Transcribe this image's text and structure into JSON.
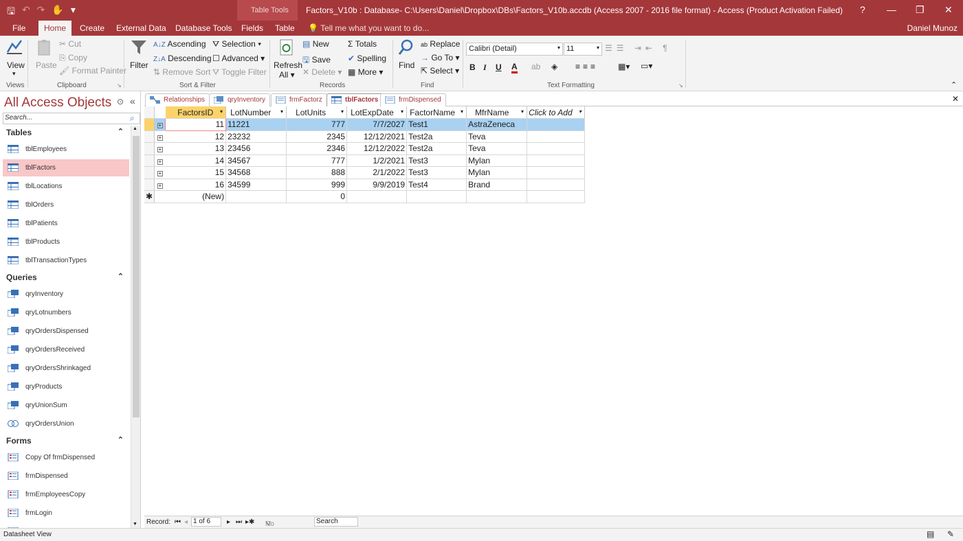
{
  "title": {
    "window_title": "Factors_V10b : Database- C:\\Users\\Daniel\\Dropbox\\DBs\\Factors_V10b.accdb (Access 2007 - 2016 file format) - Access (Product Activation Failed)",
    "contextual_tab_group": "Table Tools",
    "help": "?",
    "minimize": "—",
    "restore": "❐",
    "close": "✕"
  },
  "ribbon_tabs": [
    "File",
    "Home",
    "Create",
    "External Data",
    "Database Tools",
    "Fields",
    "Table"
  ],
  "tell_me": "Tell me what you want to do...",
  "user": "Daniel Munoz",
  "ribbon": {
    "views": {
      "view": "View",
      "label": "Views"
    },
    "clipboard": {
      "paste": "Paste",
      "cut": "Cut",
      "copy": "Copy",
      "format_painter": "Format Painter",
      "label": "Clipboard"
    },
    "sort_filter": {
      "filter": "Filter",
      "ascending": "Ascending",
      "descending": "Descending",
      "remove_sort": "Remove Sort",
      "selection": "Selection",
      "advanced": "Advanced",
      "toggle_filter": "Toggle Filter",
      "label": "Sort & Filter"
    },
    "records": {
      "refresh": "Refresh",
      "refresh_all": "All",
      "new": "New",
      "save": "Save",
      "delete": "Delete",
      "totals": "Totals",
      "spelling": "Spelling",
      "more": "More",
      "label": "Records"
    },
    "find": {
      "find": "Find",
      "replace": "Replace",
      "goto": "Go To",
      "select": "Select",
      "label": "Find"
    },
    "text_formatting": {
      "font": "Calibri (Detail)",
      "size": "11",
      "bold": "B",
      "italic": "I",
      "underline": "U",
      "font_color": "A",
      "label": "Text Formatting"
    }
  },
  "nav_pane": {
    "title": "All Access Objects",
    "search_placeholder": "Search...",
    "sections": [
      {
        "name": "Tables",
        "items": [
          "tblEmployees",
          "tblFactors",
          "tblLocations",
          "tblOrders",
          "tblPatients",
          "tblProducts",
          "tblTransactionTypes"
        ]
      },
      {
        "name": "Queries",
        "items": [
          "qryInventory",
          "qryLotnumbers",
          "qryOrdersDispensed",
          "qryOrdersReceived",
          "qryOrdersShrinkaged",
          "qryProducts",
          "qryUnionSum",
          "qryOrdersUnion"
        ]
      },
      {
        "name": "Forms",
        "items": [
          "Copy Of frmDispensed",
          "frmDispensed",
          "frmEmployeesCopy",
          "frmLogin",
          "frmMain"
        ]
      }
    ],
    "selected": "tblFactors"
  },
  "doc_tabs": [
    "Relationships",
    "qryInventory",
    "frmFactorz",
    "tblFactors",
    "frmDispensed"
  ],
  "active_doc_tab": "tblFactors",
  "datasheet": {
    "columns": [
      "FactorsID",
      "LotNumber",
      "LotUnits",
      "LotExpDate",
      "FactorName",
      "MfrName",
      "Click to Add"
    ],
    "rows": [
      [
        "11",
        "11221",
        "777",
        "7/7/2027",
        "Test1",
        "AstraZeneca"
      ],
      [
        "12",
        "23232",
        "2345",
        "12/12/2021",
        "Test2a",
        "Teva"
      ],
      [
        "13",
        "23456",
        "2346",
        "12/12/2022",
        "Test2a",
        "Teva"
      ],
      [
        "14",
        "34567",
        "777",
        "1/2/2021",
        "Test3",
        "Mylan"
      ],
      [
        "15",
        "34568",
        "888",
        "2/1/2022",
        "Test3",
        "Mylan"
      ],
      [
        "16",
        "34599",
        "999",
        "9/9/2019",
        "Test4",
        "Brand"
      ]
    ],
    "new_row": {
      "id": "(New)",
      "units": "0"
    }
  },
  "record_nav": {
    "label": "Record:",
    "position": "1 of 6",
    "filter": "No Filter",
    "search": "Search"
  },
  "status": "Datasheet View"
}
